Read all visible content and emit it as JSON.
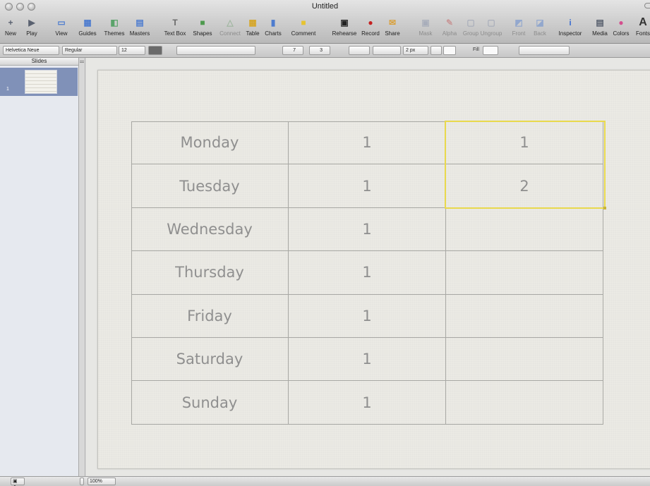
{
  "window": {
    "title": "Untitled"
  },
  "toolbar": {
    "items": [
      {
        "label": "New",
        "icon": "plus-icon",
        "glyph": "+",
        "color": "#5a6170",
        "enabled": true
      },
      {
        "label": "Play",
        "icon": "play-icon",
        "glyph": "▶",
        "color": "#5a6170",
        "enabled": true
      },
      {
        "label": "View",
        "icon": "view-icon",
        "glyph": "▭",
        "color": "#4d7ccf",
        "enabled": true
      },
      {
        "label": "Guides",
        "icon": "guides-icon",
        "glyph": "▦",
        "color": "#4d7ccf",
        "enabled": true
      },
      {
        "label": "Themes",
        "icon": "themes-icon",
        "glyph": "◧",
        "color": "#5aa36a",
        "enabled": true
      },
      {
        "label": "Masters",
        "icon": "masters-icon",
        "glyph": "▤",
        "color": "#4d7ccf",
        "enabled": true
      },
      {
        "label": "Text Box",
        "icon": "text-box-icon",
        "glyph": "T",
        "color": "#6a6a6a",
        "enabled": true
      },
      {
        "label": "Shapes",
        "icon": "shapes-icon",
        "glyph": "■",
        "color": "#4e9a4e",
        "enabled": true
      },
      {
        "label": "Connect",
        "icon": "connect-icon",
        "glyph": "△",
        "color": "#6a9c6a",
        "enabled": false
      },
      {
        "label": "Table",
        "icon": "table-icon",
        "glyph": "▦",
        "color": "#d6a626",
        "enabled": true
      },
      {
        "label": "Charts",
        "icon": "charts-icon",
        "glyph": "▮",
        "color": "#4d7ccf",
        "enabled": true
      },
      {
        "label": "Comment",
        "icon": "comment-icon",
        "glyph": "■",
        "color": "#e6c330",
        "enabled": true
      },
      {
        "label": "Rehearse",
        "icon": "rehearse-icon",
        "glyph": "▣",
        "color": "#222222",
        "enabled": true
      },
      {
        "label": "Record",
        "icon": "record-icon",
        "glyph": "●",
        "color": "#c42121",
        "enabled": true
      },
      {
        "label": "Share",
        "icon": "share-icon",
        "glyph": "✉",
        "color": "#d9a03a",
        "enabled": true
      },
      {
        "label": "Mask",
        "icon": "mask-icon",
        "glyph": "▣",
        "color": "#7f8aa6",
        "enabled": false
      },
      {
        "label": "Alpha",
        "icon": "alpha-icon",
        "glyph": "✎",
        "color": "#c25a5a",
        "enabled": false
      },
      {
        "label": "Group",
        "icon": "group-icon",
        "glyph": "▢",
        "color": "#7f8aa6",
        "enabled": false
      },
      {
        "label": "Ungroup",
        "icon": "ungroup-icon",
        "glyph": "▢",
        "color": "#7f8aa6",
        "enabled": false
      },
      {
        "label": "Front",
        "icon": "front-icon",
        "glyph": "◩",
        "color": "#4d7ccf",
        "enabled": false
      },
      {
        "label": "Back",
        "icon": "back-icon",
        "glyph": "◪",
        "color": "#4d7ccf",
        "enabled": false
      },
      {
        "label": "Inspector",
        "icon": "inspector-icon",
        "glyph": "i",
        "color": "#3d6fd0",
        "enabled": true
      },
      {
        "label": "Media",
        "icon": "media-icon",
        "glyph": "▤",
        "color": "#555d6b",
        "enabled": true
      },
      {
        "label": "Colors",
        "icon": "colors-icon",
        "glyph": "●",
        "color": "#d44f8e",
        "enabled": true
      },
      {
        "label": "Fonts",
        "icon": "fonts-icon",
        "glyph": "A",
        "color": "#333333",
        "enabled": true
      }
    ]
  },
  "formatbar": {
    "font_family": "Helvetica Neue",
    "font_style": "Regular",
    "font_size": "12",
    "rows_value": "7",
    "columns_value": "3",
    "stroke_width": "2 px",
    "fill_label": "Fill"
  },
  "navigator": {
    "header": "Slides",
    "slide_number": "1"
  },
  "table": {
    "rows": [
      [
        "Monday",
        "1",
        "1"
      ],
      [
        "Tuesday",
        "1",
        "2"
      ],
      [
        "Wednesday",
        "1",
        ""
      ],
      [
        "Thursday",
        "1",
        ""
      ],
      [
        "Friday",
        "1",
        ""
      ],
      [
        "Saturday",
        "1",
        ""
      ],
      [
        "Sunday",
        "1",
        ""
      ]
    ],
    "text_color": "#8f8f8f",
    "border_color": "#a8a8a4",
    "selection_color": "#e9d94d"
  },
  "statusbar": {
    "zoom": "100%"
  }
}
